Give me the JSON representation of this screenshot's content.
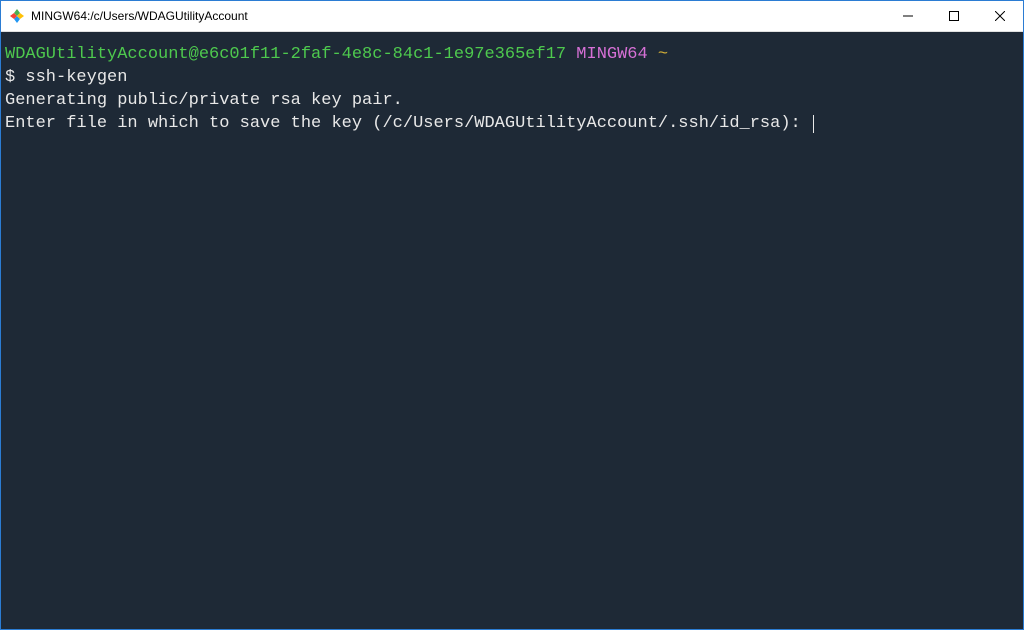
{
  "window": {
    "title": "MINGW64:/c/Users/WDAGUtilityAccount"
  },
  "terminal": {
    "prompt": {
      "user_host": "WDAGUtilityAccount@e6c01f11-2faf-4e8c-84c1-1e97e365ef17",
      "system": "MINGW64",
      "path": "~",
      "symbol": "$ ",
      "command": "ssh-keygen"
    },
    "output": {
      "line1": "Generating public/private rsa key pair.",
      "line2": "Enter file in which to save the key (/c/Users/WDAGUtilityAccount/.ssh/id_rsa): "
    }
  }
}
